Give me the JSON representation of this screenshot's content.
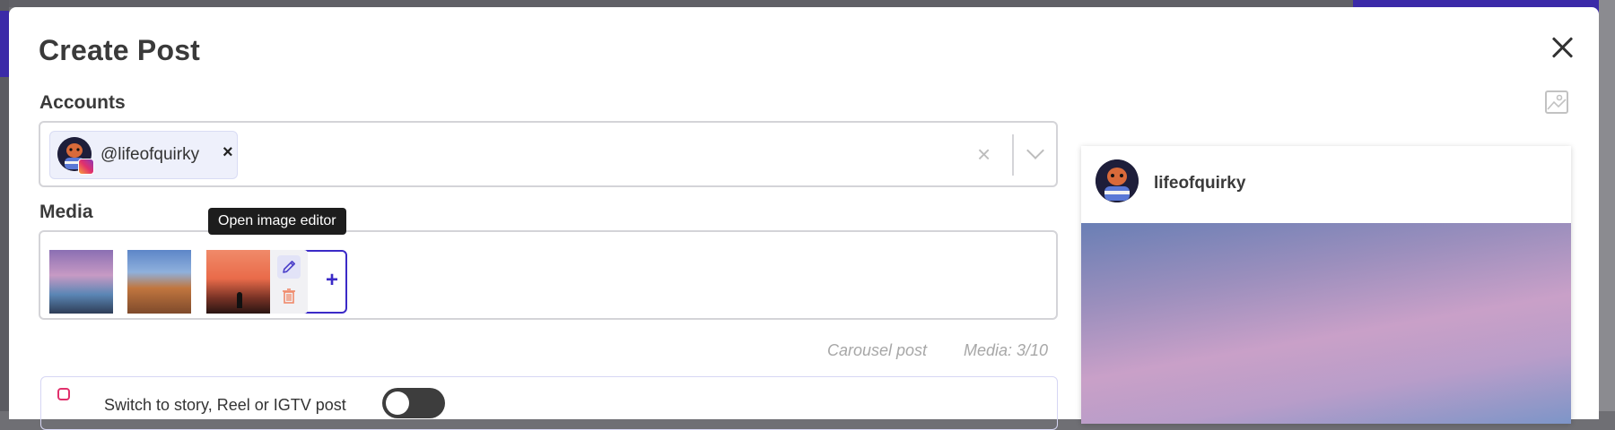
{
  "modal": {
    "title": "Create Post",
    "accounts_label": "Accounts",
    "media_label": "Media"
  },
  "accounts": {
    "selected": [
      {
        "handle": "@lifeofquirky",
        "network_icon": "instagram-icon",
        "remove": "×"
      }
    ]
  },
  "media": {
    "items": [
      {
        "name": "sea-stacks-sunset"
      },
      {
        "name": "delicate-arch"
      },
      {
        "name": "orange-sunset-silhouette"
      }
    ],
    "tooltip": "Open image editor",
    "add": "+"
  },
  "post_info": {
    "type": "Carousel post",
    "count": "Media: 3/10"
  },
  "story_toggle": {
    "label": "Switch to story, Reel or IGTV post",
    "enabled": false
  },
  "preview": {
    "username": "lifeofquirky"
  },
  "colors": {
    "accent": "#3b2ac7",
    "chip_bg": "#eef0fb",
    "delete": "#f08a6a"
  }
}
